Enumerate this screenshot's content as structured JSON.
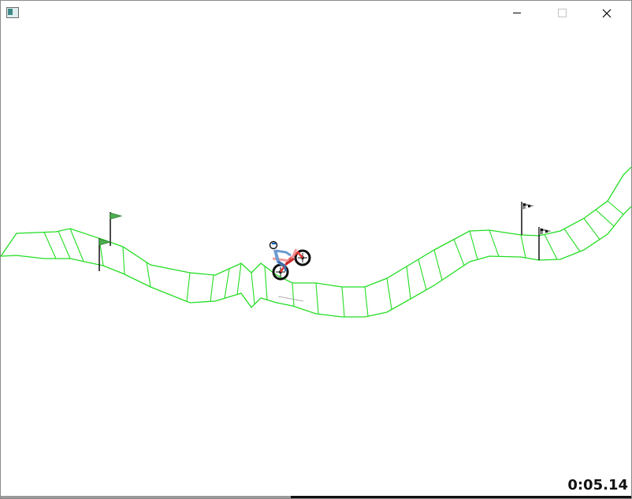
{
  "window": {
    "title": "",
    "controls": {
      "minimize_icon": "minimize-icon",
      "maximize_icon": "maximize-icon",
      "close_icon": "close-icon"
    }
  },
  "game": {
    "timer": "0:05.14",
    "progress_fraction": 0.46,
    "colors": {
      "track": "#22dd22",
      "flag_start": "#4caf50",
      "rider_body": "#6b9bd1",
      "bike_frame": "#e53935",
      "wheels": "#111111"
    },
    "flags": [
      {
        "kind": "start-checkpoint"
      },
      {
        "kind": "start-checkpoint"
      },
      {
        "kind": "finish-checkered"
      },
      {
        "kind": "finish-checkered"
      }
    ]
  }
}
